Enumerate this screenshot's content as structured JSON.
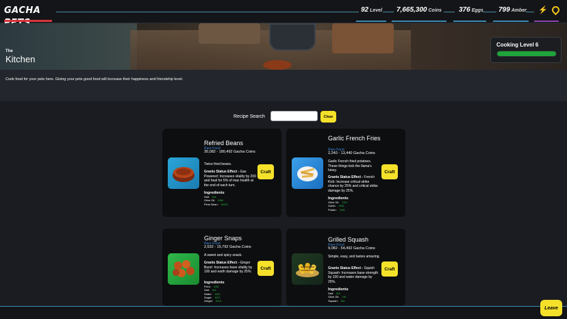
{
  "header": {
    "logo": "GACHA PETS",
    "stats": [
      {
        "value": "92",
        "unit": "Level"
      },
      {
        "value": "7,665,300",
        "unit": "Coins"
      },
      {
        "value": "376",
        "unit": "Eggs"
      },
      {
        "value": "799",
        "unit": "Amber"
      }
    ],
    "icons": [
      "lightning-icon",
      "location-pin-icon"
    ]
  },
  "hero": {
    "subtitle": "The",
    "title": "Kitchen"
  },
  "cooking": {
    "label": "Cooking Level 6",
    "progress": 1.0,
    "bar_color": "#1fa33a"
  },
  "description": "Cook food for your pets here. Giving your pets good food will increase their happiness and friendship level.",
  "search": {
    "label": "Recipe Search",
    "value": "",
    "placeholder": "",
    "clear_label": "Clear"
  },
  "recipes": [
    {
      "name": "Refried Beans",
      "rarity": "Rare Food",
      "price": "30,082 - 180,492 Gacha Coins",
      "blurb": "Twice fried beans.",
      "effect_label": "Grants Status Effect -",
      "effect_text": "Gas Powered: Increases vitality by 200 and heal for 5% of max health at the end of each turn.",
      "ingredients_title": "Ingredients",
      "ingredients": [
        {
          "name": "Salt:",
          "amount": "0/4"
        },
        {
          "name": "Olive Oil:",
          "amount": "0/60"
        },
        {
          "name": "Pinto Bean:",
          "amount": "0/412"
        }
      ],
      "craft_label": "Craft",
      "thumb_icon": "refried-beans-icon"
    },
    {
      "name": "Garlic French Fries",
      "rarity": "Rare Food",
      "price": "2,240 - 13,440 Gacha Coins",
      "blurb": "Garlic French fried potatoes. These things kick the llama's hiney.",
      "effect_label": "Grants Status Effect -",
      "effect_text": "French Kick: Increase critical strike chance by 25% and critical strike damage by 25%.",
      "ingredients_title": "Ingredients",
      "ingredients": [
        {
          "name": "Olive Oil:",
          "amount": "7/12"
        },
        {
          "name": "Garlic:",
          "amount": "2/10"
        },
        {
          "name": "Potato:",
          "amount": "1/40"
        }
      ],
      "craft_label": "Craft",
      "thumb_icon": "french-fries-icon"
    },
    {
      "name": "Ginger Snaps",
      "rarity": "Rare Food",
      "price": "2,632 - 15,792 Gacha Coins",
      "blurb": "A sweet and spicy snack.",
      "effect_label": "Grants Status Effect -",
      "effect_text": "Ginger Burst: Increases base vitality by 100 and earth damage by 25%.",
      "ingredients_title": "Ingredients",
      "ingredients": [
        {
          "name": "Flour:",
          "amount": "0/11"
        },
        {
          "name": "Salt:",
          "amount": "0/4"
        },
        {
          "name": "Water:",
          "amount": "0/41"
        },
        {
          "name": "Sugar:",
          "amount": "0/17"
        },
        {
          "name": "Ginger:",
          "amount": "0/14"
        }
      ],
      "craft_label": "Craft",
      "thumb_icon": "ginger-snaps-icon"
    },
    {
      "name": "Grilled Squash",
      "rarity": "Rare Food",
      "price": "9,082 - 54,492 Gacha Coins",
      "blurb": "Simple, easy, and tastes amazing.",
      "effect_label": "Grants Status Effect -",
      "effect_text": "Squish Squash: Increases base strength by 100 and water damage by 25%.",
      "ingredients_title": "Ingredients",
      "ingredients": [
        {
          "name": "Salt:",
          "amount": "0/4"
        },
        {
          "name": "Olive Oil:",
          "amount": "7/8"
        },
        {
          "name": "Squash:",
          "amount": "0/4"
        }
      ],
      "craft_label": "Craft",
      "thumb_icon": "grilled-squash-icon"
    }
  ],
  "footer": {
    "leave_label": "Leave"
  }
}
